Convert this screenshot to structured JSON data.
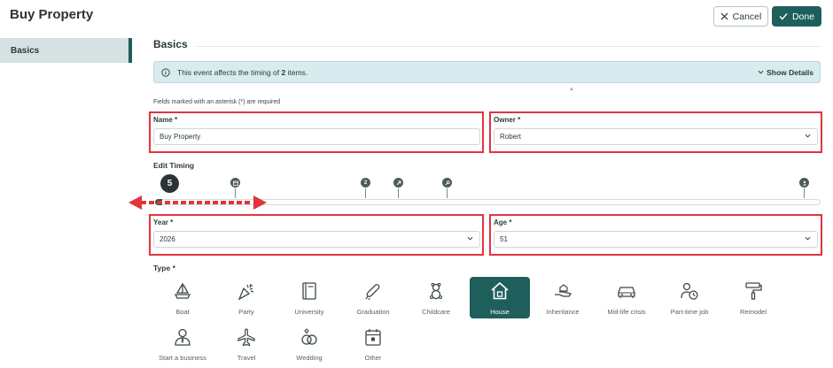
{
  "header": {
    "title": "Buy Property",
    "cancel_label": "Cancel",
    "done_label": "Done"
  },
  "sidebar": {
    "items": [
      {
        "label": "Basics",
        "active": true
      }
    ]
  },
  "section": {
    "title": "Basics"
  },
  "banner": {
    "text_before": "This event affects the timing of",
    "count": "2",
    "text_after": "items.",
    "show_details_label": "Show Details"
  },
  "form": {
    "required_note": "Fields marked with an asterisk (*) are required",
    "name": {
      "label": "Name *",
      "value": "Buy Property"
    },
    "owner": {
      "label": "Owner *",
      "value": "Robert"
    },
    "edit_timing_label": "Edit Timing",
    "year": {
      "label": "Year *",
      "value": "2026"
    },
    "age": {
      "label": "Age *",
      "value": "51"
    },
    "type_label": "Type *"
  },
  "timeline": {
    "current_marker": "5",
    "markers": [
      "calendar-icon",
      "2",
      "retirement-icon",
      "key-icon",
      "end-icon"
    ]
  },
  "types": [
    {
      "label": "Boat",
      "icon": "boat-icon"
    },
    {
      "label": "Party",
      "icon": "party-icon"
    },
    {
      "label": "University",
      "icon": "book-icon"
    },
    {
      "label": "Graduation",
      "icon": "diploma-icon"
    },
    {
      "label": "Childcare",
      "icon": "teddy-bear-icon"
    },
    {
      "label": "House",
      "icon": "house-icon",
      "selected": true
    },
    {
      "label": "Inheritance",
      "icon": "inheritance-icon"
    },
    {
      "label": "Mid-life crisis",
      "icon": "car-icon"
    },
    {
      "label": "Part-time job",
      "icon": "part-time-icon"
    },
    {
      "label": "Remodel",
      "icon": "paint-roller-icon"
    },
    {
      "label": "Start a business",
      "icon": "business-icon"
    },
    {
      "label": "Travel",
      "icon": "airplane-icon"
    },
    {
      "label": "Wedding",
      "icon": "rings-icon"
    },
    {
      "label": "Other",
      "icon": "calendar-icon"
    }
  ],
  "colors": {
    "accent": "#1e5f5b",
    "banner": "#d8ebee",
    "highlight": "#e0353d",
    "sidebar_active": "#d4e2e3"
  }
}
